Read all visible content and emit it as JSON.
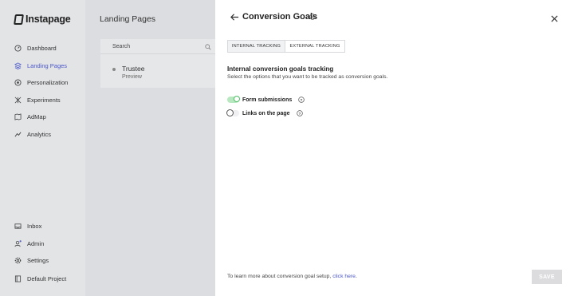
{
  "brand": {
    "name": "Instapage"
  },
  "sidebar": {
    "top_items": [
      {
        "label": "Dashboard",
        "icon": "gauge-icon"
      },
      {
        "label": "Landing Pages",
        "icon": "layers-icon",
        "active": true
      },
      {
        "label": "Personalization",
        "icon": "target-icon"
      },
      {
        "label": "Experiments",
        "icon": "flask-icon"
      },
      {
        "label": "AdMap",
        "icon": "map-icon"
      },
      {
        "label": "Analytics",
        "icon": "chart-icon"
      }
    ],
    "bottom_items": [
      {
        "label": "Inbox",
        "icon": "inbox-icon"
      },
      {
        "label": "Admin",
        "icon": "user-icon"
      },
      {
        "label": "Settings",
        "icon": "gear-icon"
      },
      {
        "label": "Default Project",
        "icon": "folder-icon"
      }
    ]
  },
  "main": {
    "title": "Landing Pages",
    "search_placeholder": "Search",
    "row": {
      "title": "Trustee",
      "subtitle": "Preview"
    }
  },
  "modal": {
    "title": "Conversion Goals",
    "tabs": [
      {
        "label": "INTERNAL TRACKING",
        "active": true
      },
      {
        "label": "EXTERNAL TRACKING",
        "active": false
      }
    ],
    "section_title": "Internal conversion goals tracking",
    "section_desc": "Select the options that you want to be tracked as conversion goals.",
    "options": [
      {
        "label": "Form submissions",
        "enabled": true
      },
      {
        "label": "Links on the page",
        "enabled": false
      }
    ],
    "footer_text": "To learn more about conversion goal setup,",
    "footer_link": "click here",
    "footer_period": ".",
    "save_label": "SAVE"
  },
  "colors": {
    "accent": "#4a57c9",
    "toggle_on": "#4cbf63"
  }
}
